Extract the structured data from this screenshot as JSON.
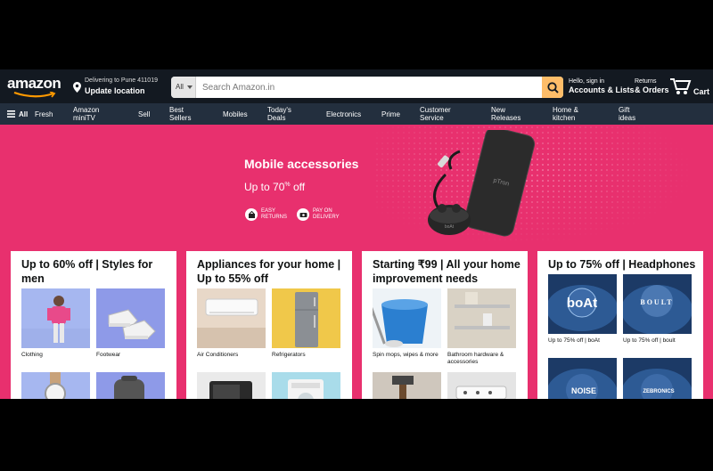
{
  "header": {
    "logo_text": "amazon",
    "logo_suffix": ".in",
    "deliver_line1": "Delivering to Pune 411019",
    "deliver_line2": "Update location",
    "search_category": "All",
    "search_placeholder": "Search Amazon.in",
    "account_line1": "Hello, sign in",
    "account_line2": "Accounts & Lists",
    "returns_line1": "Returns",
    "returns_line2": "& Orders",
    "cart_label": "Cart"
  },
  "nav": {
    "all": "All",
    "items": [
      {
        "line1": "Fresh",
        "line2": ""
      },
      {
        "line1": "Amazon",
        "line2": "miniTV"
      },
      {
        "line1": "Sell",
        "line2": ""
      },
      {
        "line1": "Best",
        "line2": "Sellers"
      },
      {
        "line1": "Mobiles",
        "line2": ""
      },
      {
        "line1": "Today's",
        "line2": "Deals"
      },
      {
        "line1": "Electronics",
        "line2": ""
      },
      {
        "line1": "Prime",
        "line2": ""
      },
      {
        "line1": "Customer",
        "line2": "Service"
      },
      {
        "line1": "New",
        "line2": "Releases"
      },
      {
        "line1": "Home &",
        "line2": "kitchen"
      },
      {
        "line1": "Gift",
        "line2": "ideas"
      }
    ]
  },
  "hero": {
    "title": "Mobile accessories",
    "offer_prefix": "Up to 70",
    "offer_sup": "%",
    "offer_suffix": " off",
    "badge1_line1": "EASY",
    "badge1_line2": "RETURNS",
    "badge2_line1": "PAY ON",
    "badge2_line2": "DELIVERY",
    "product_brand": "pTron",
    "earbuds_brand": "boAt"
  },
  "cards": [
    {
      "title": "Up to 60% off | Styles for men",
      "tiles": [
        {
          "caption": "Clothing"
        },
        {
          "caption": "Footwear"
        },
        {
          "caption": ""
        },
        {
          "caption": ""
        }
      ]
    },
    {
      "title": "Appliances for your home | Up to 55% off",
      "tiles": [
        {
          "caption": "Air Conditioners"
        },
        {
          "caption": "Refrigerators"
        },
        {
          "caption": ""
        },
        {
          "caption": ""
        }
      ]
    },
    {
      "title": "Starting ₹99 | All your home improvement needs",
      "tiles": [
        {
          "caption": "Spin mops, wipes & more"
        },
        {
          "caption": "Bathroom hardware & accessories"
        },
        {
          "caption": ""
        },
        {
          "caption": ""
        }
      ]
    },
    {
      "title": "Up to 75% off | Headphones",
      "tiles": [
        {
          "caption": "Up to 75% off | boAt",
          "logo": "boAt"
        },
        {
          "caption": "Up to 75% off | boult",
          "logo": "BOULT"
        },
        {
          "caption": "",
          "logo": "NOISE"
        },
        {
          "caption": "",
          "logo": "ZEBRONICS"
        }
      ]
    }
  ],
  "colors": {
    "header_bg": "#131921",
    "nav_bg": "#232f3e",
    "hero_bg": "#e8306e",
    "search_button": "#febd69"
  }
}
